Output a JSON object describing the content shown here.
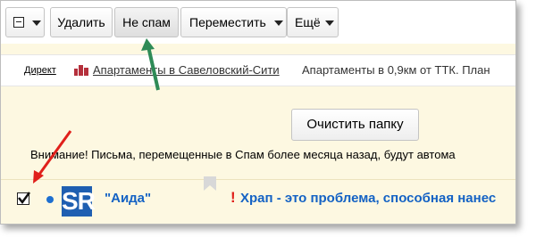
{
  "toolbar": {
    "delete_label": "Удалить",
    "not_spam_label": "Не спам",
    "move_label": "Переместить",
    "more_label": "Ещё"
  },
  "ad": {
    "label": "Директ",
    "link": "Апартаменты в Савеловский-Сити",
    "text": "Апартаменты в 0,9км от ТТК. План"
  },
  "main": {
    "clean_button": "Очистить папку",
    "notice": "Внимание! Письма, перемещенные в Спам более месяца назад, будут автома"
  },
  "message": {
    "avatar_text": "SR",
    "sender": "\"Аида\"",
    "important_mark": "!",
    "subject": "Храп - это проблема, способная нанес"
  },
  "colors": {
    "accent_blue": "#1462c4",
    "important_red": "#e0201b",
    "background": "#fdf8e1",
    "arrow_green": "#2e8b57",
    "arrow_red": "#e0201b"
  },
  "icons": [
    "checkbox-select-icon",
    "caret-down-icon",
    "direct-logo-icon",
    "bookmark-icon",
    "checkmark-icon"
  ]
}
